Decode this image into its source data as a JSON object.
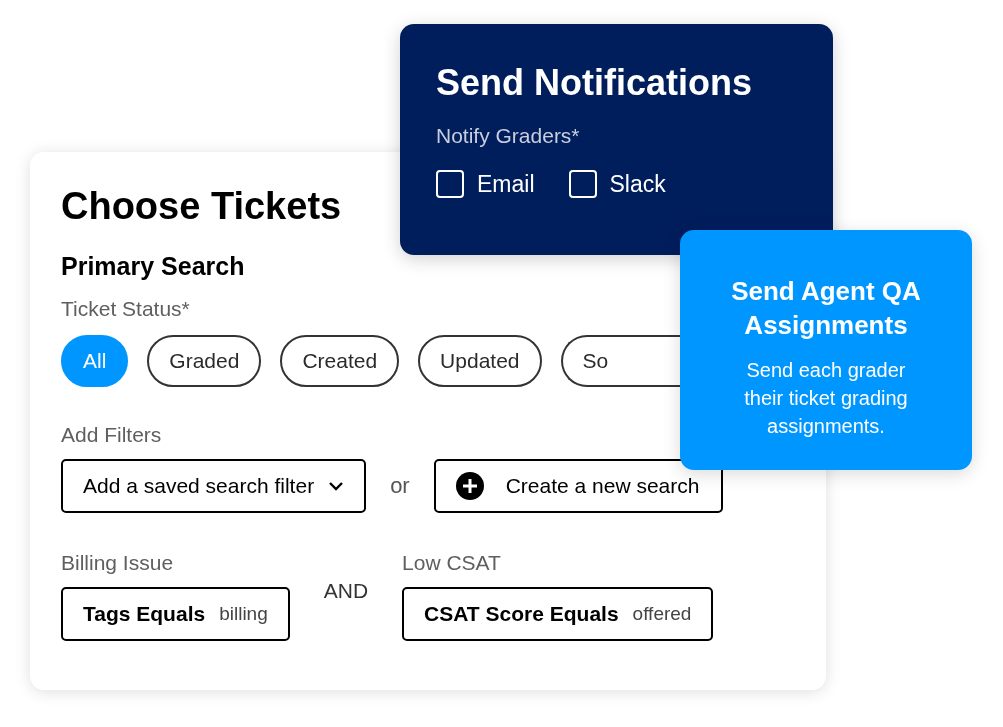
{
  "choose_tickets": {
    "title": "Choose Tickets",
    "subtitle": "Primary Search",
    "status_label": "Ticket Status*",
    "statuses": [
      {
        "label": "All",
        "selected": true
      },
      {
        "label": "Graded",
        "selected": false
      },
      {
        "label": "Created",
        "selected": false
      },
      {
        "label": "Updated",
        "selected": false
      },
      {
        "label": "So",
        "selected": false
      }
    ],
    "filters_label": "Add Filters",
    "saved_filter": "Add a saved search filter",
    "or": "or",
    "create_button": "Create a new search",
    "conditions": [
      {
        "name": "Billing Issue",
        "field": "Tags Equals",
        "value": "billing"
      },
      {
        "name": "Low CSAT",
        "field": "CSAT Score Equals",
        "value": "offered"
      }
    ],
    "joiner": "AND"
  },
  "notifications": {
    "title": "Send Notifications",
    "label": "Notify Graders*",
    "channels": [
      {
        "label": "Email",
        "checked": false
      },
      {
        "label": "Slack",
        "checked": false
      }
    ]
  },
  "assignments": {
    "title": "Send Agent QA Assignments",
    "body": "Send each grader their ticket grading assignments."
  }
}
